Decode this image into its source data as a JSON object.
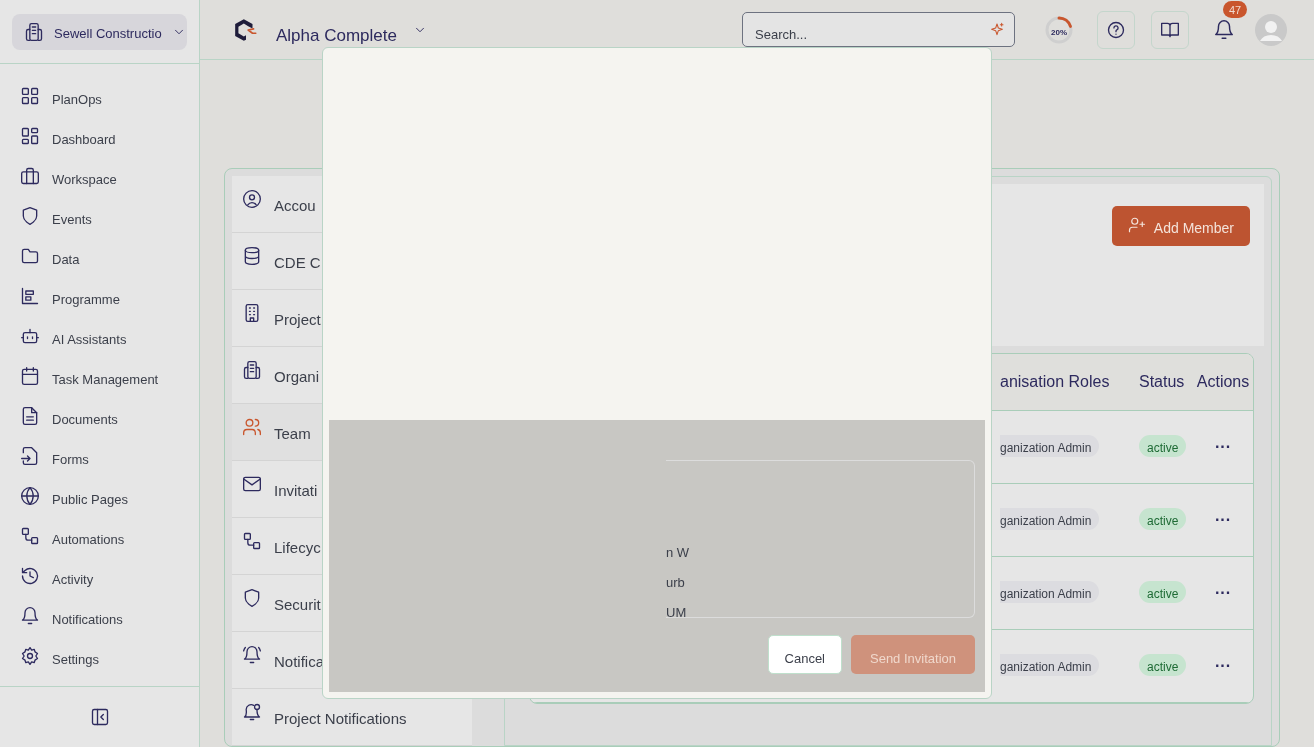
{
  "org_selector": {
    "label": "Sewell Constructio"
  },
  "sidebar": {
    "items": [
      {
        "label": "PlanOps"
      },
      {
        "label": "Dashboard"
      },
      {
        "label": "Workspace"
      },
      {
        "label": "Events"
      },
      {
        "label": "Data"
      },
      {
        "label": "Programme"
      },
      {
        "label": "AI Assistants"
      },
      {
        "label": "Task Management"
      },
      {
        "label": "Documents"
      },
      {
        "label": "Forms"
      },
      {
        "label": "Public Pages"
      },
      {
        "label": "Automations"
      },
      {
        "label": "Activity"
      },
      {
        "label": "Notifications"
      },
      {
        "label": "Settings"
      }
    ]
  },
  "header": {
    "project": "Alpha Complete",
    "search": {
      "placeholder": "Search..."
    },
    "progress": {
      "level": 0.2,
      "reading": "20%"
    },
    "notification_count": "47"
  },
  "settings_nav": {
    "items": [
      {
        "label": "Accou",
        "selected": false
      },
      {
        "label": "CDE C",
        "selected": false
      },
      {
        "label": "Project",
        "selected": false
      },
      {
        "label": "Organi",
        "selected": false
      },
      {
        "label": "Team",
        "selected": true
      },
      {
        "label": "Invitati",
        "selected": false
      },
      {
        "label": "Lifecyc",
        "selected": false
      },
      {
        "label": "Securit",
        "selected": false
      },
      {
        "label": "Notifica",
        "selected": false
      },
      {
        "label": "Project Notifications",
        "selected": false
      }
    ]
  },
  "team": {
    "add_button": "Add Member",
    "table": {
      "columns": [
        "anisation Roles",
        "Status",
        "Actions"
      ],
      "rows": [
        {
          "role": "ganization Admin",
          "status": "active",
          "actions": "···"
        },
        {
          "role": "ganization Admin",
          "status": "active",
          "actions": "···"
        },
        {
          "role": "ganization Admin",
          "status": "active",
          "actions": "···"
        },
        {
          "role": "ganization Admin",
          "status": "active",
          "actions": "···"
        }
      ]
    }
  },
  "dialog": {
    "field_lines": [
      "n W",
      "urb",
      "UM"
    ],
    "buttons": [
      {
        "label": "Cancel",
        "kind": "secondary",
        "disabled": false
      },
      {
        "label": "Send Invitation",
        "kind": "primary",
        "disabled": true
      }
    ]
  }
}
